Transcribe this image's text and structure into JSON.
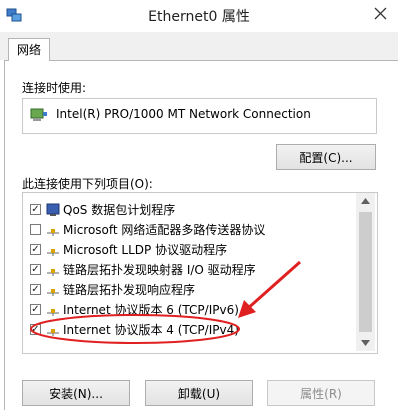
{
  "window": {
    "title": "Ethernet0 属性"
  },
  "tabs": [
    {
      "label": "网络"
    }
  ],
  "connect_using": {
    "label": "连接时使用:",
    "adapter": "Intel(R) PRO/1000 MT Network Connection",
    "configure_label": "配置(C)..."
  },
  "items_section": {
    "label": "此连接使用下列项目(O):"
  },
  "items": [
    {
      "label": "QoS 数据包计划程序",
      "checked": true,
      "icon": "qos-icon"
    },
    {
      "label": "Microsoft 网络适配器多路传送器协议",
      "checked": false,
      "icon": "protocol-icon"
    },
    {
      "label": "Microsoft LLDP 协议驱动程序",
      "checked": true,
      "icon": "protocol-icon"
    },
    {
      "label": "链路层拓扑发现映射器 I/O 驱动程序",
      "checked": true,
      "icon": "protocol-icon"
    },
    {
      "label": "链路层拓扑发现响应程序",
      "checked": true,
      "icon": "protocol-icon"
    },
    {
      "label": "Internet 协议版本 6 (TCP/IPv6)",
      "checked": true,
      "icon": "protocol-icon"
    },
    {
      "label": "Internet 协议版本 4 (TCP/IPv4)",
      "checked": true,
      "icon": "protocol-icon"
    }
  ],
  "buttons": {
    "install": "安装(N)...",
    "uninstall": "卸载(U)",
    "properties": "属性(R)"
  },
  "annotation": {
    "color": "#e02020"
  }
}
